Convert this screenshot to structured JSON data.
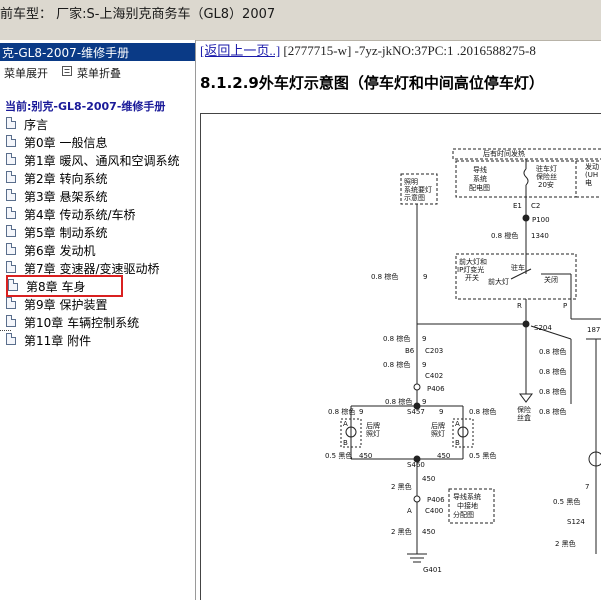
{
  "titlebar": {
    "text": "前车型：  厂家:S-上海别克商务车（GL8）2007"
  },
  "sidebar": {
    "header": "克-GL8-2007-维修手册",
    "expand_label": "菜单展开",
    "collapse_label": "菜单折叠",
    "current": "当前:别克-GL8-2007-维修手册",
    "items": [
      {
        "label": "序言"
      },
      {
        "label": "第0章 一般信息"
      },
      {
        "label": "第1章 暖风、通风和空调系统"
      },
      {
        "label": "第2章 转向系统"
      },
      {
        "label": "第3章 悬架系统"
      },
      {
        "label": "第4章 传动系统/车桥"
      },
      {
        "label": "第5章 制动系统"
      },
      {
        "label": "第6章 发动机"
      },
      {
        "label": "第7章 变速器/变速驱动桥"
      },
      {
        "label": "第8章 车身"
      },
      {
        "label": "第9章 保护装置"
      },
      {
        "label": "第10章 车辆控制系统"
      },
      {
        "label": "第11章 附件"
      }
    ],
    "selected_index": 9
  },
  "content": {
    "back_link": "[返回上一页..]",
    "doc_info": "[2777715-w] -7yz-jkNO:37PC:1 .2016588275-8",
    "title": "8.1.2.9外车灯示意图（停车灯和中间高位停车灯）"
  },
  "diagram": {
    "top_box": "后有时间发热",
    "fuse_box": [
      "导线",
      "系统",
      "配电图"
    ],
    "fuse_label": [
      "驻车灯",
      "保险丝",
      "20安"
    ],
    "right_label": [
      "发动",
      "(UH",
      "电"
    ],
    "e1": "E1",
    "c2": "C2",
    "p100": "P100",
    "w_orange_1340": "0.8 橙色",
    "n1340": "1340",
    "lighting_box": [
      "照明",
      "系统要灯",
      "示意图"
    ],
    "switch_label": [
      "前大灯和",
      "IP灯变光",
      "开关"
    ],
    "switch_park": "驻车",
    "switch_headlamp": "前大灯",
    "switch_off": "关闭",
    "w_brown_9a": "0.8 棕色",
    "n9a": "9",
    "r": "R",
    "p": "P",
    "n187": "187",
    "s204": "S204",
    "w_brown_9b": "0.8 棕色",
    "n9b": "9",
    "b6": "B6",
    "c203": "C203",
    "w_brown_9c": "0.8 棕色",
    "n9c": "9",
    "c402": "C402",
    "p406a": "P406",
    "w_brown_9d": "0.8 棕色",
    "n9d": "9",
    "w_brown_9e": "0.8 棕色",
    "n9e": "9",
    "w_brown_9f": "0.8 棕色",
    "n9f": "9",
    "w_brown_9g": "0.8 棕色",
    "n9g": "9",
    "s457": "S457",
    "rear_lamp_left": [
      "后牌",
      "照灯"
    ],
    "rear_lamp_right": [
      "后牌",
      "照灯"
    ],
    "a1": "A",
    "b1": "B",
    "a2": "A",
    "b2": "B",
    "w_black_450a": "0.5 黑色",
    "n450a": "450",
    "w_black_450b": "0.5 黑色",
    "n450b": "450",
    "s460": "S460",
    "w_black_450c": "2 黑色",
    "n450c": "450",
    "p406b": "P406",
    "a3": "A",
    "c400": "C400",
    "ground_box": [
      "导线系统",
      "中接地",
      "分配图"
    ],
    "w_black_450d": "2 黑色",
    "n450d": "450",
    "g401": "G401",
    "fuse_park": [
      "保险",
      "丝盒"
    ],
    "w_brown_r1": "0.8 棕色",
    "w_brown_r2": "0.8 棕色",
    "w_brown_r3": "0.8 棕色",
    "w_brown_r4": "0.8 棕色",
    "n7": "7",
    "w_black_r": "0.5 黑色",
    "s124": "S124",
    "w_black_r2": "2 黑色"
  }
}
